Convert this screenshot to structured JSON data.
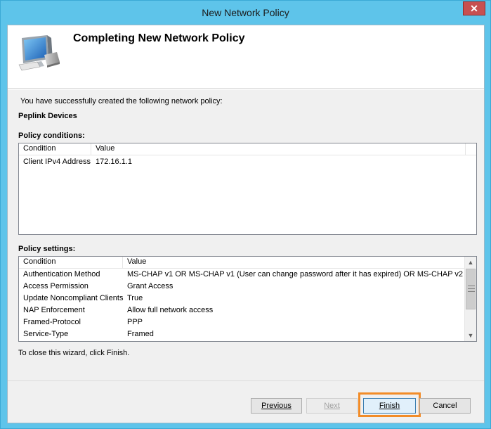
{
  "window": {
    "title": "New Network Policy",
    "close_glyph": "✕"
  },
  "header": {
    "title": "Completing New Network Policy",
    "icon": "computer-monitor-icon"
  },
  "body": {
    "success_text": "You have successfully created the following network policy:",
    "policy_name": "Peplink Devices",
    "conditions_label": "Policy conditions:",
    "settings_label": "Policy settings:",
    "close_hint": "To close this wizard, click Finish."
  },
  "conditions_table": {
    "columns": [
      "Condition",
      "Value"
    ],
    "rows": [
      {
        "condition": "Client IPv4 Address",
        "value": "172.16.1.1"
      }
    ]
  },
  "settings_table": {
    "columns": [
      "Condition",
      "Value"
    ],
    "rows": [
      {
        "condition": "Authentication Method",
        "value": "MS-CHAP v1 OR MS-CHAP v1 (User can change password after it has expired) OR MS-CHAP v2 ..."
      },
      {
        "condition": "Access Permission",
        "value": "Grant Access"
      },
      {
        "condition": "Update Noncompliant Clients",
        "value": "True"
      },
      {
        "condition": "NAP Enforcement",
        "value": "Allow full network access"
      },
      {
        "condition": "Framed-Protocol",
        "value": "PPP"
      },
      {
        "condition": "Service-Type",
        "value": "Framed"
      }
    ]
  },
  "buttons": {
    "previous": "Previous",
    "next": "Next",
    "finish": "Finish",
    "cancel": "Cancel"
  },
  "colors": {
    "frame": "#5ec4ea",
    "highlight": "#f28c28"
  }
}
